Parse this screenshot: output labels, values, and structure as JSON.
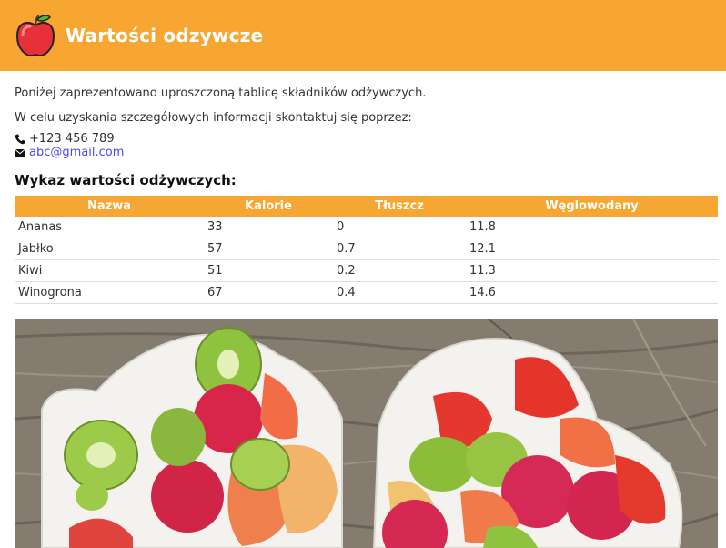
{
  "header": {
    "title": "Wartości odzywcze",
    "logo_icon": "apple-icon",
    "background": "#f7a632"
  },
  "intro_text": "Poniżej zaprezentowano uproszczoną tablicę składników odżywczych.",
  "contact": {
    "intro": "W celu uzyskania szczegółowych informacji skontaktuj się poprzez:",
    "phone_icon": "phone-icon",
    "phone": "+123 456 789",
    "email_icon": "envelope-icon",
    "email": "abc@gmail.com"
  },
  "table": {
    "heading": "Wykaz wartości odżywczych:",
    "columns": [
      "Nazwa",
      "Kalorie",
      "Tłuszcz",
      "Węglowodany"
    ],
    "rows": [
      [
        "Ananas",
        "33",
        "0",
        "11.8"
      ],
      [
        "Jabłko",
        "57",
        "0.7",
        "12.1"
      ],
      [
        "Kiwi",
        "51",
        "0.2",
        "11.3"
      ],
      [
        "Winogrona",
        "67",
        "0.4",
        "14.6"
      ]
    ]
  },
  "photo": {
    "subject": "fruit-salad-in-heart-bowls"
  }
}
